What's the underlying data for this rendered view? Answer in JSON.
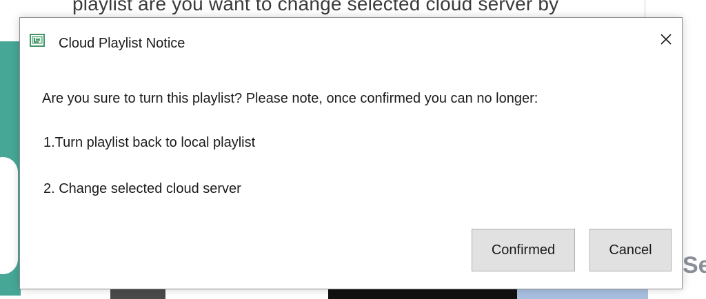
{
  "dialog": {
    "title": "Cloud Playlist Notice",
    "icon": "playlist-app-icon",
    "close_icon": "close-icon",
    "message": "Are you sure to turn this playlist? Please note, once confirmed you can no longer:",
    "items": [
      "1.Turn playlist back to local playlist",
      "2. Change selected cloud server"
    ],
    "buttons": {
      "confirm_label": "Confirmed",
      "cancel_label": "Cancel"
    }
  },
  "background": {
    "top_text": "playlist are you want to change selected cloud server by",
    "right_text": "Se"
  },
  "colors": {
    "icon_green": "#2e8b57",
    "teal_panel": "#46a796",
    "button_bg": "#e1e1e1"
  }
}
